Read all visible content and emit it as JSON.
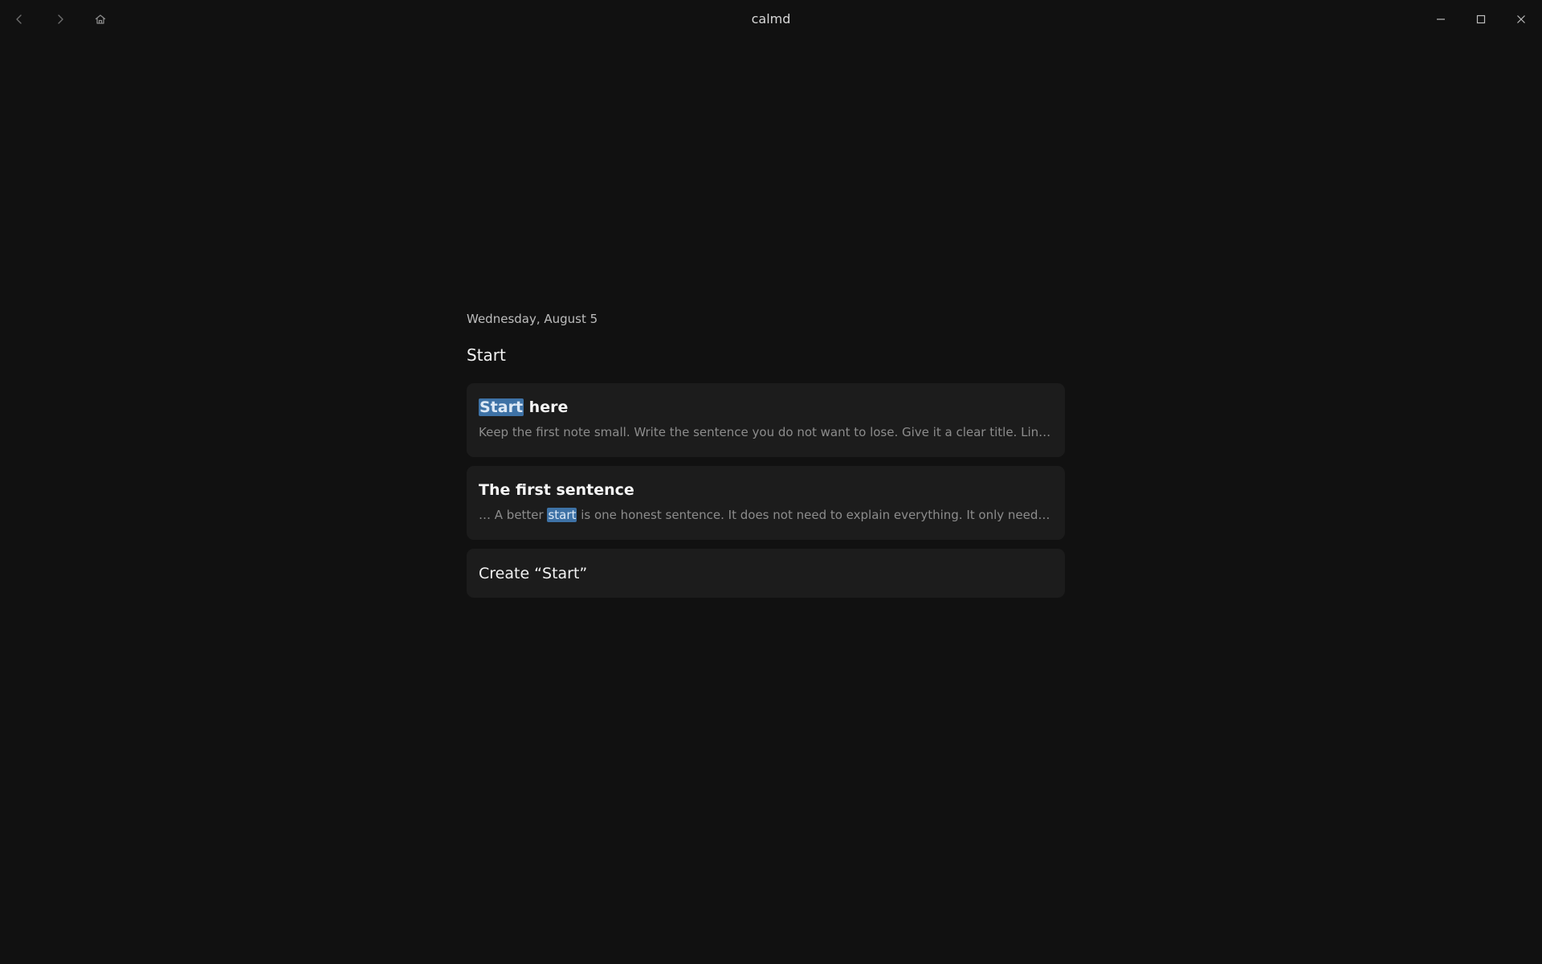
{
  "window": {
    "title": "calmd",
    "nav": {
      "back_icon": "chevron-left-icon",
      "forward_icon": "chevron-right-icon",
      "home_icon": "home-icon"
    },
    "controls": {
      "minimize_icon": "minimize-icon",
      "maximize_icon": "maximize-icon",
      "close_icon": "close-icon"
    }
  },
  "main": {
    "date": "Wednesday, August 5",
    "query": "Start",
    "results": [
      {
        "title_highlight": "Start",
        "title_rest": " here",
        "snippet_before": "",
        "snippet_highlight": "",
        "snippet_after": "Keep the first note small. Write the sentence you do not want to lose. Give it a clear title. Lin …"
      },
      {
        "title": "The first sentence",
        "snippet_before": "… A better ",
        "snippet_highlight": "start",
        "snippet_after": " is one honest sentence. It does not need to explain everything. It only needs t…"
      }
    ],
    "create_label": "Create “Start”"
  },
  "colors": {
    "background": "#111111",
    "card": "#1c1c1c",
    "highlight": "#3e72a6",
    "snippet_text": "#8c8c8c"
  }
}
